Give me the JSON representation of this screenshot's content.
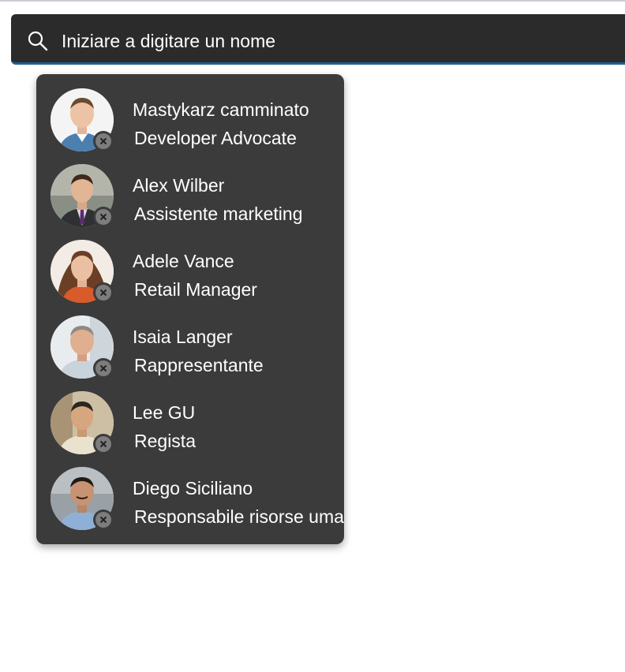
{
  "search": {
    "placeholder": "Iniziare a digitare un nome",
    "icon": "search-icon"
  },
  "colors": {
    "search_bg": "#2b2b2b",
    "search_accent": "#1f5f94",
    "flyout_bg": "#3b3b3b",
    "text": "#ffffff"
  },
  "people": [
    {
      "name": "Mastykarz camminato",
      "title": "Developer Advocate",
      "remove_icon": "remove-circle-icon"
    },
    {
      "name": "Alex Wilber",
      "title": "Assistente marketing",
      "remove_icon": "remove-circle-icon"
    },
    {
      "name": "Adele Vance",
      "title": "Retail Manager",
      "remove_icon": "remove-circle-icon"
    },
    {
      "name": "Isaia Langer",
      "title": "Rappresentante",
      "remove_icon": "remove-circle-icon"
    },
    {
      "name": "Lee GU",
      "title": "Regista",
      "remove_icon": "remove-circle-icon"
    },
    {
      "name": "Diego Siciliano",
      "title": "Responsabile risorse umane",
      "remove_icon": "remove-circle-icon"
    }
  ]
}
